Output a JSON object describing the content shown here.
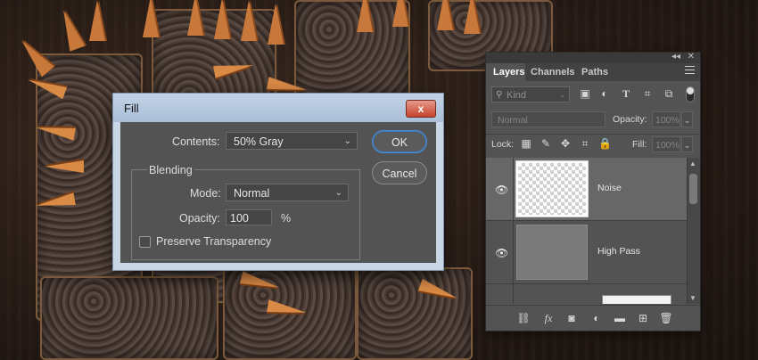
{
  "fill_dialog": {
    "title": "Fill",
    "close_label": "x",
    "contents_label": "Contents:",
    "contents_value": "50% Gray",
    "ok_label": "OK",
    "cancel_label": "Cancel",
    "blending_label": "Blending",
    "mode_label": "Mode:",
    "mode_value": "Normal",
    "opacity_label": "Opacity:",
    "opacity_value": "100",
    "opacity_unit": "%",
    "preserve_label": "Preserve Transparency",
    "preserve_checked": false
  },
  "layers_panel": {
    "collapse_glyph": "◂◂",
    "close_glyph": "✕",
    "tabs": [
      "Layers",
      "Channels",
      "Paths"
    ],
    "active_tab": "Layers",
    "filter": {
      "kind_placeholder": "Kind",
      "icons": [
        "image-filter-icon",
        "adjustment-filter-icon",
        "type-filter-icon",
        "shape-filter-icon",
        "smart-object-filter-icon"
      ]
    },
    "blend_mode": "Normal",
    "opacity_label": "Opacity:",
    "opacity_value": "100%",
    "lock_label": "Lock:",
    "lock_icons": [
      "lock-transparent-icon",
      "lock-paint-icon",
      "lock-position-icon",
      "artboard-icon",
      "lock-all-icon"
    ],
    "fill_label": "Fill:",
    "fill_value": "100%",
    "layers": [
      {
        "name": "Noise",
        "thumbnail": "transparent",
        "visible": true,
        "selected": true
      },
      {
        "name": "High Pass",
        "thumbnail": "gray",
        "visible": true,
        "selected": false
      },
      {
        "name": "",
        "thumbnail": "white",
        "visible": false,
        "selected": false
      }
    ],
    "footer_icons": [
      "link-layers-icon",
      "fx-icon",
      "mask-icon",
      "adjustment-layer-icon",
      "group-folder-icon",
      "new-layer-icon",
      "trash-icon"
    ]
  },
  "colors": {
    "dialog_frame": "#c9d6e6",
    "dialog_body": "#535353",
    "panel_bg": "#535353",
    "selected_layer": "#676767",
    "ok_focus": "#4d8fd6",
    "close_button": "#c5442c",
    "spike_copper": "#c8783a"
  }
}
